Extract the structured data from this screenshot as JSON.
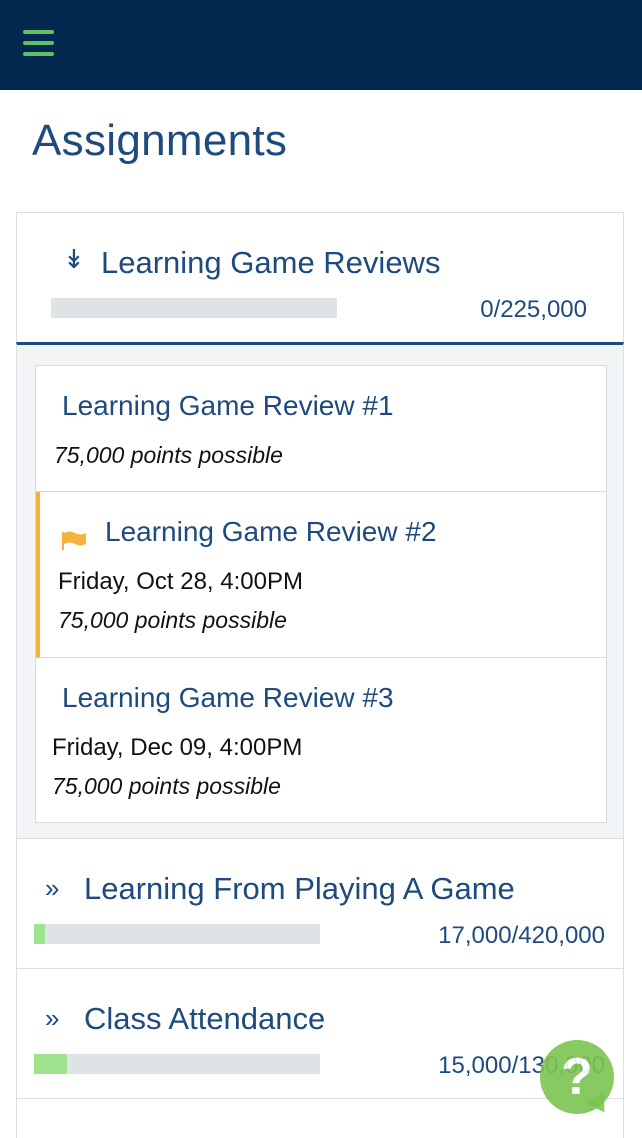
{
  "header": {
    "menu_icon": "hamburger-icon"
  },
  "page_title": "Assignments",
  "categories": [
    {
      "title": "Learning Game Reviews",
      "score": "0/225,000",
      "progress": 0,
      "expanded": true,
      "chevron": "chevron-double-down-icon"
    },
    {
      "title": "Learning From Playing A Game",
      "score": "17,000/420,000",
      "progress": 0.04,
      "expanded": false,
      "chevron": "chevron-double-right-icon"
    },
    {
      "title": "Class Attendance",
      "score": "15,000/130,000",
      "progress": 0.115,
      "expanded": false,
      "chevron": "chevron-double-right-icon"
    }
  ],
  "assignments": [
    {
      "title": "Learning Game Review #1",
      "date": "",
      "points": "75,000 points possible",
      "flagged": false
    },
    {
      "title": "Learning Game Review #2",
      "date": "Friday, Oct 28, 4:00PM",
      "points": "75,000 points possible",
      "flagged": true
    },
    {
      "title": "Learning Game Review #3",
      "date": "Friday, Dec 09, 4:00PM",
      "points": "75,000 points possible",
      "flagged": false
    }
  ],
  "help": {
    "label": "?",
    "icon": "help-bubble-icon"
  },
  "colors": {
    "navy": "#02284f",
    "accent_green": "#5fc06a",
    "text_blue": "#1f4a7d",
    "flag_orange": "#f6b23a",
    "progress_green": "#9ee48f"
  }
}
